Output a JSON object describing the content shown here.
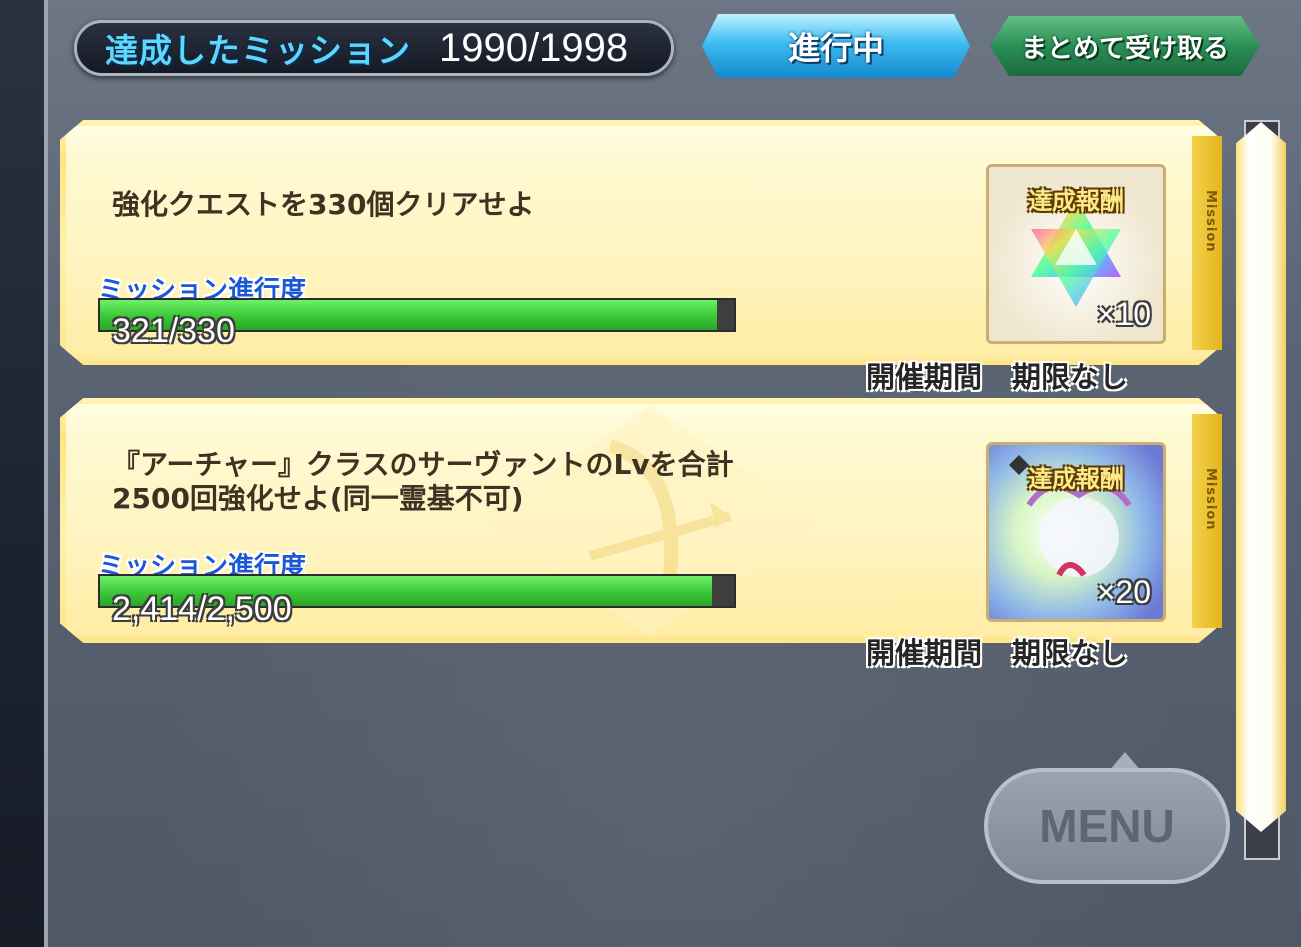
{
  "header": {
    "title": "達成したミッション",
    "count": "1990/1998",
    "tab_label": "進行中",
    "collect_label": "まとめて受け取る"
  },
  "missions": [
    {
      "text": "強化クエストを330個クリアせよ",
      "progress_label": "ミッション進行度",
      "progress_text": "321/330",
      "progress_fraction": 0.973,
      "reward_label": "達成報酬",
      "reward_icon": "saint-quartz-icon",
      "reward_qty": "×10",
      "period_label": "開催期間",
      "period_value": "期限なし",
      "side_label": "Mission"
    },
    {
      "text_line1": "『アーチャー』クラスのサーヴァントのLvを合計",
      "text_line2": "2500回強化せよ(同一霊基不可)",
      "progress_label": "ミッション進行度",
      "progress_text": "2,414/2,500",
      "progress_fraction": 0.966,
      "reward_label": "達成報酬",
      "reward_icon": "servant-ember-icon",
      "reward_qty": "×20",
      "period_label": "開催期間",
      "period_value": "期限なし",
      "side_label": "Mission"
    }
  ],
  "menu": {
    "label": "MENU"
  },
  "colors": {
    "accent_blue": "#5ed7ff",
    "progress_green": "#3ecb3a",
    "card_gold": "#ffe680"
  }
}
